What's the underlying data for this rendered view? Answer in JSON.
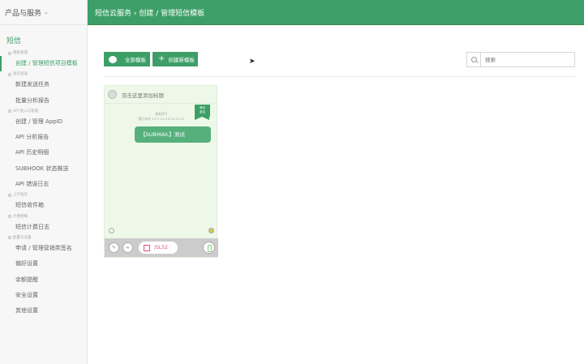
{
  "sidebar": {
    "product_selector": "产品与服务",
    "section_title": "短信",
    "groups": [
      {
        "label": "模板管理",
        "items": [
          {
            "label": "创建 / 管理短信项目模板",
            "active": true
          }
        ]
      },
      {
        "label": "短信发送",
        "items": [
          {
            "label": "新建发送任务"
          },
          {
            "label": "批量分析报告"
          }
        ]
      },
      {
        "label": "API 接入与管理",
        "items": [
          {
            "label": "创建 / 管理 AppID"
          },
          {
            "label": "API 分析报告"
          },
          {
            "label": "API 历史明细"
          },
          {
            "label": "SUBHOOK 状态推送"
          },
          {
            "label": "API 错误日志"
          }
        ]
      },
      {
        "label": "上行短信",
        "items": [
          {
            "label": "短信收件箱"
          }
        ]
      },
      {
        "label": "计费明细",
        "items": [
          {
            "label": "短信计费日志"
          }
        ]
      },
      {
        "label": "配置与设置",
        "items": [
          {
            "label": "申请 / 管理营销类签名"
          },
          {
            "label": "偏好设置"
          },
          {
            "label": "余额提醒"
          },
          {
            "label": "安全设置"
          },
          {
            "label": "其他设置"
          }
        ]
      }
    ]
  },
  "header": {
    "breadcrumb": "短信云服务 › 创建 / 管理短信模板"
  },
  "toolbar": {
    "all_templates": "全部模板",
    "new_template": "创建新模板"
  },
  "search": {
    "placeholder": "搜索"
  },
  "template_card": {
    "title_placeholder": "双击这里添加标题",
    "flag_line1": "等待",
    "flag_line2": "激活",
    "meta_line1": "模板序号",
    "meta_line2": "最后修改 2017-03-16 09:32:55",
    "message": "【SUBMAIL】测试",
    "sms_button": "/SL52"
  }
}
